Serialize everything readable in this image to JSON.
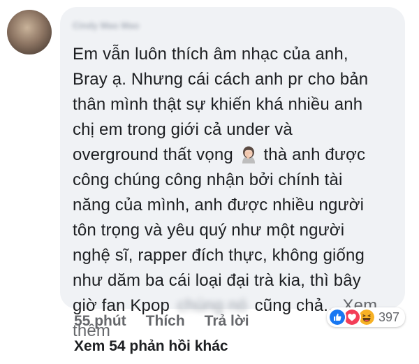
{
  "comment": {
    "author": "Cindy Mao Mao",
    "lines": [
      "Em vẫn luôn thích âm nhạc của anh,",
      "Bray ạ. Nhưng cái cách anh pr cho bản",
      "thân mình thật sự khiến khá nhiều anh",
      "chị em trong giới cả under và",
      "overground thất vọng",
      "thà anh được",
      "công chúng công nhận bởi chính tài",
      "năng của mình, anh được nhiều người",
      "tôn trọng và yêu quý như một người",
      "nghệ sĩ, rapper đích thực, không giống",
      "như dăm ba cái loại đại trà kia, thì bây",
      "giờ fan Kpop",
      "chúng nó",
      "cũng chả...",
      "Xem",
      "thêm"
    ],
    "emoji_icon": "woman-facepalming-icon"
  },
  "reactions": {
    "icons": [
      "like-icon",
      "love-icon",
      "haha-icon"
    ],
    "count": "397",
    "colors": {
      "like": "#1877f2",
      "love": "#f33e58",
      "haha": "#f7b125"
    }
  },
  "actions": {
    "time": "55 phút",
    "like_label": "Thích",
    "reply_label": "Trả lời"
  },
  "more_replies": "Xem 54 phản hồi khác",
  "colors": {
    "bubble": "#f0f2f5",
    "text": "#1c1e21",
    "meta": "#65676b"
  }
}
